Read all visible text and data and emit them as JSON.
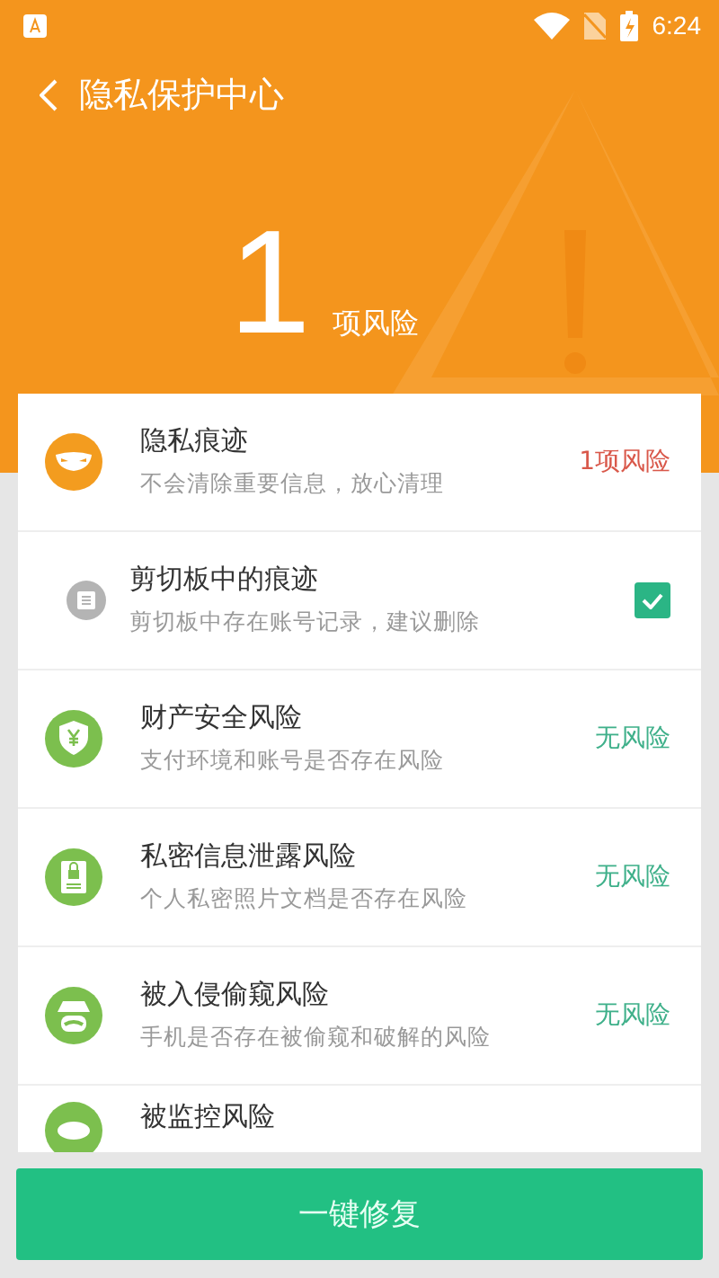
{
  "status_bar": {
    "time": "6:24"
  },
  "header": {
    "title": "隐私保护中心"
  },
  "summary": {
    "count": "1",
    "unit": "项风险"
  },
  "items": [
    {
      "kind": "category",
      "title": "隐私痕迹",
      "subtitle": "不会清除重要信息，放心清理",
      "status": "1项风险",
      "color": "#d9584a"
    },
    {
      "kind": "sub",
      "title": "剪切板中的痕迹",
      "subtitle": "剪切板中存在账号记录，建议删除",
      "checked": true
    },
    {
      "kind": "category",
      "title": "财产安全风险",
      "subtitle": "支付环境和账号是否存在风险",
      "status": "无风险",
      "color": "#3fb08a"
    },
    {
      "kind": "category",
      "title": "私密信息泄露风险",
      "subtitle": "个人私密照片文档是否存在风险",
      "status": "无风险",
      "color": "#3fb08a"
    },
    {
      "kind": "category",
      "title": "被入侵偷窥风险",
      "subtitle": "手机是否存在被偷窥和破解的风险",
      "status": "无风险",
      "color": "#3fb08a"
    },
    {
      "kind": "category",
      "title": "被监控风险"
    }
  ],
  "action_button": {
    "label": "一键修复"
  }
}
